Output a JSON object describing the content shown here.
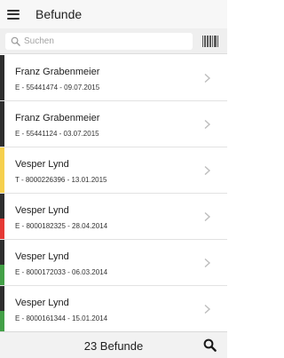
{
  "header": {
    "menu_icon": "hamburger-menu-icon",
    "title": "Befunde"
  },
  "search": {
    "placeholder": "Suchen",
    "value": "",
    "search_icon": "magnifier-icon",
    "barcode_icon": "barcode-scan-icon"
  },
  "items": [
    {
      "name": "Franz Grabenmeier",
      "meta": "E - 55441474 - 09.07.2015",
      "status_color": "#2e2e2e"
    },
    {
      "name": "Franz Grabenmeier",
      "meta": "E - 55441124 - 03.07.2015",
      "status_color": "#2e2e2e"
    },
    {
      "name": "Vesper Lynd",
      "meta": "T - 8000226396 - 13.01.2015",
      "status_color": "#f6d04d"
    },
    {
      "name": "Vesper Lynd",
      "meta": "E - 8000182325 - 28.04.2014",
      "status_color": "#2e2e2e",
      "status_color_2": "#e53935"
    },
    {
      "name": "Vesper Lynd",
      "meta": "E - 8000172033 - 06.03.2014",
      "status_color": "#2e2e2e",
      "status_color_2": "#43a047"
    },
    {
      "name": "Vesper Lynd",
      "meta": "E - 8000161344 - 15.01.2014",
      "status_color": "#2e2e2e",
      "status_color_2": "#43a047"
    }
  ],
  "footer": {
    "count_label": "23 Befunde",
    "search_icon": "magnifier-icon"
  }
}
